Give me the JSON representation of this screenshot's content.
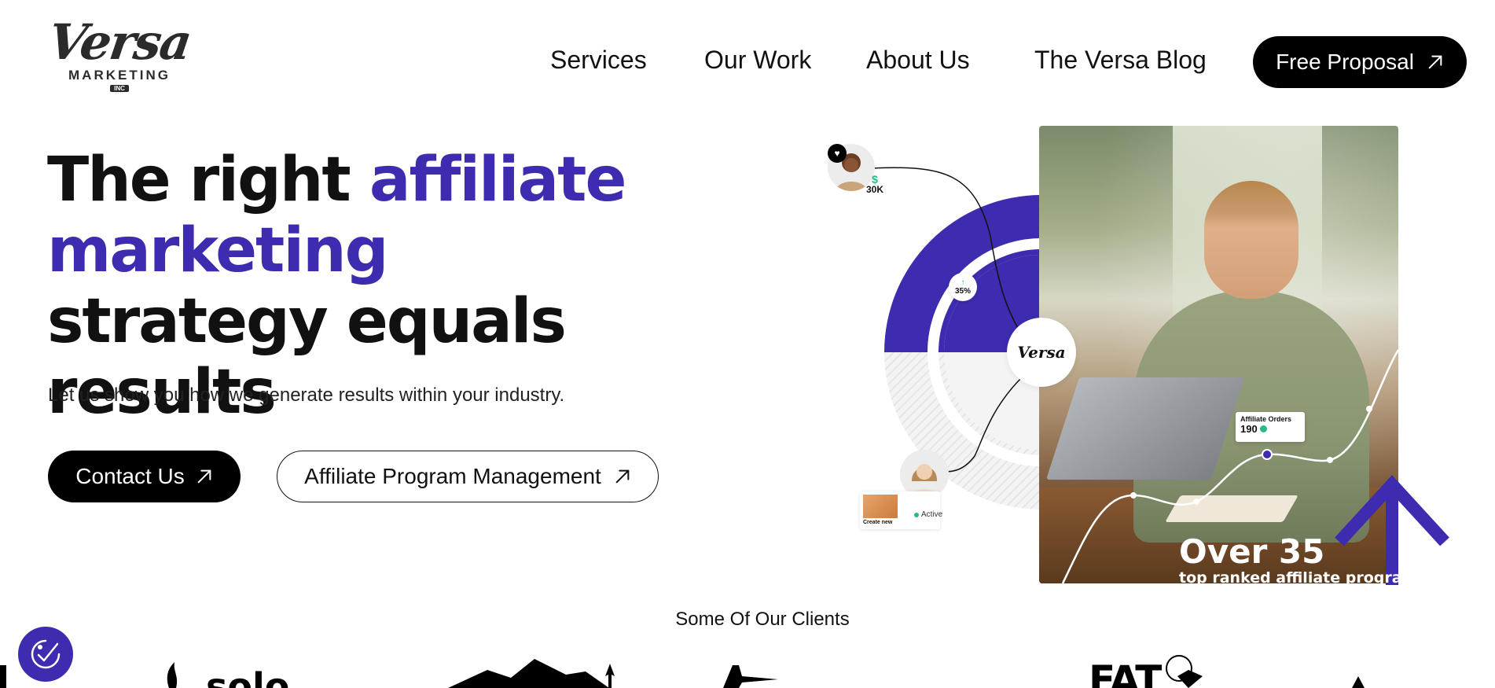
{
  "brand": {
    "name": "Versa",
    "sub": "MARKETING",
    "inc": "INC"
  },
  "nav": {
    "items": [
      {
        "label": "Services"
      },
      {
        "label": "Our Work"
      },
      {
        "label": "About Us"
      },
      {
        "label": "The Versa Blog"
      }
    ],
    "cta_label": "Free Proposal"
  },
  "hero": {
    "title_part1": "The right ",
    "title_accent": "affiliate marketing",
    "title_part2": " strategy equals results",
    "subtitle": "Let us show you how we generate results within your industry.",
    "primary_cta": "Contact Us",
    "secondary_cta": "Affiliate Program Management"
  },
  "visual": {
    "money_value": "30K",
    "money_symbol": "$",
    "percent_value": "35%",
    "logo_text": "Versa",
    "orders_label": "Affiliate Orders",
    "orders_value": "190",
    "status_label": "Active",
    "mini_card_label": "Create new",
    "stat_big": "Over 35",
    "stat_small": "top ranked affiliate programs"
  },
  "clients": {
    "heading": "Some Of Our Clients",
    "logos": [
      "solo",
      "FAT"
    ]
  },
  "colors": {
    "accent": "#3d2bb0",
    "status_green": "#28b88a",
    "black": "#000000"
  }
}
